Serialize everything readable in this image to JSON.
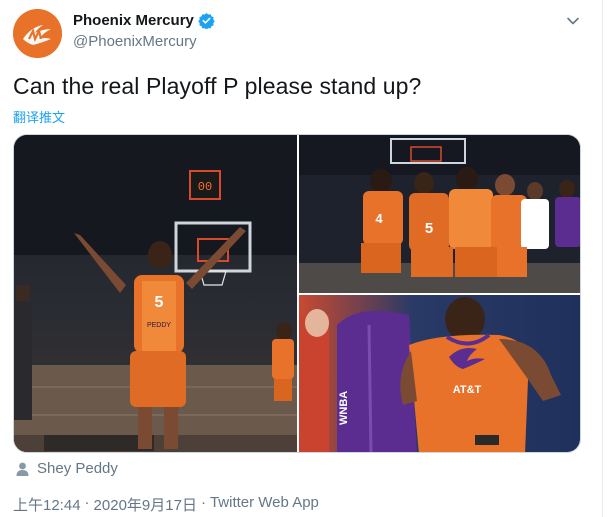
{
  "tweet": {
    "display_name": "Phoenix Mercury",
    "handle": "@PhoenixMercury",
    "verified": true,
    "text": "Can the real Playoff P please stand up?",
    "translate_label": "翻译推文",
    "tagged_person": "Shey Peddy",
    "time": "上午12:44",
    "date": "2020年9月17日",
    "separator": "·",
    "source": "Twitter Web App"
  },
  "photos": {
    "jersey_name": "PEDDY",
    "jersey_number": "5",
    "scoreboard": "00",
    "sponsor": "AT&T",
    "league": "WNBA"
  },
  "colors": {
    "brand_orange": "#e8722a",
    "mercury_purple": "#5b2d90",
    "link_blue": "#1da1f2",
    "verified_blue": "#1da1f2",
    "muted_text": "#657786"
  },
  "icons": [
    "avatar-logo",
    "verified-badge-icon",
    "chevron-down-icon",
    "person-tag-icon"
  ]
}
